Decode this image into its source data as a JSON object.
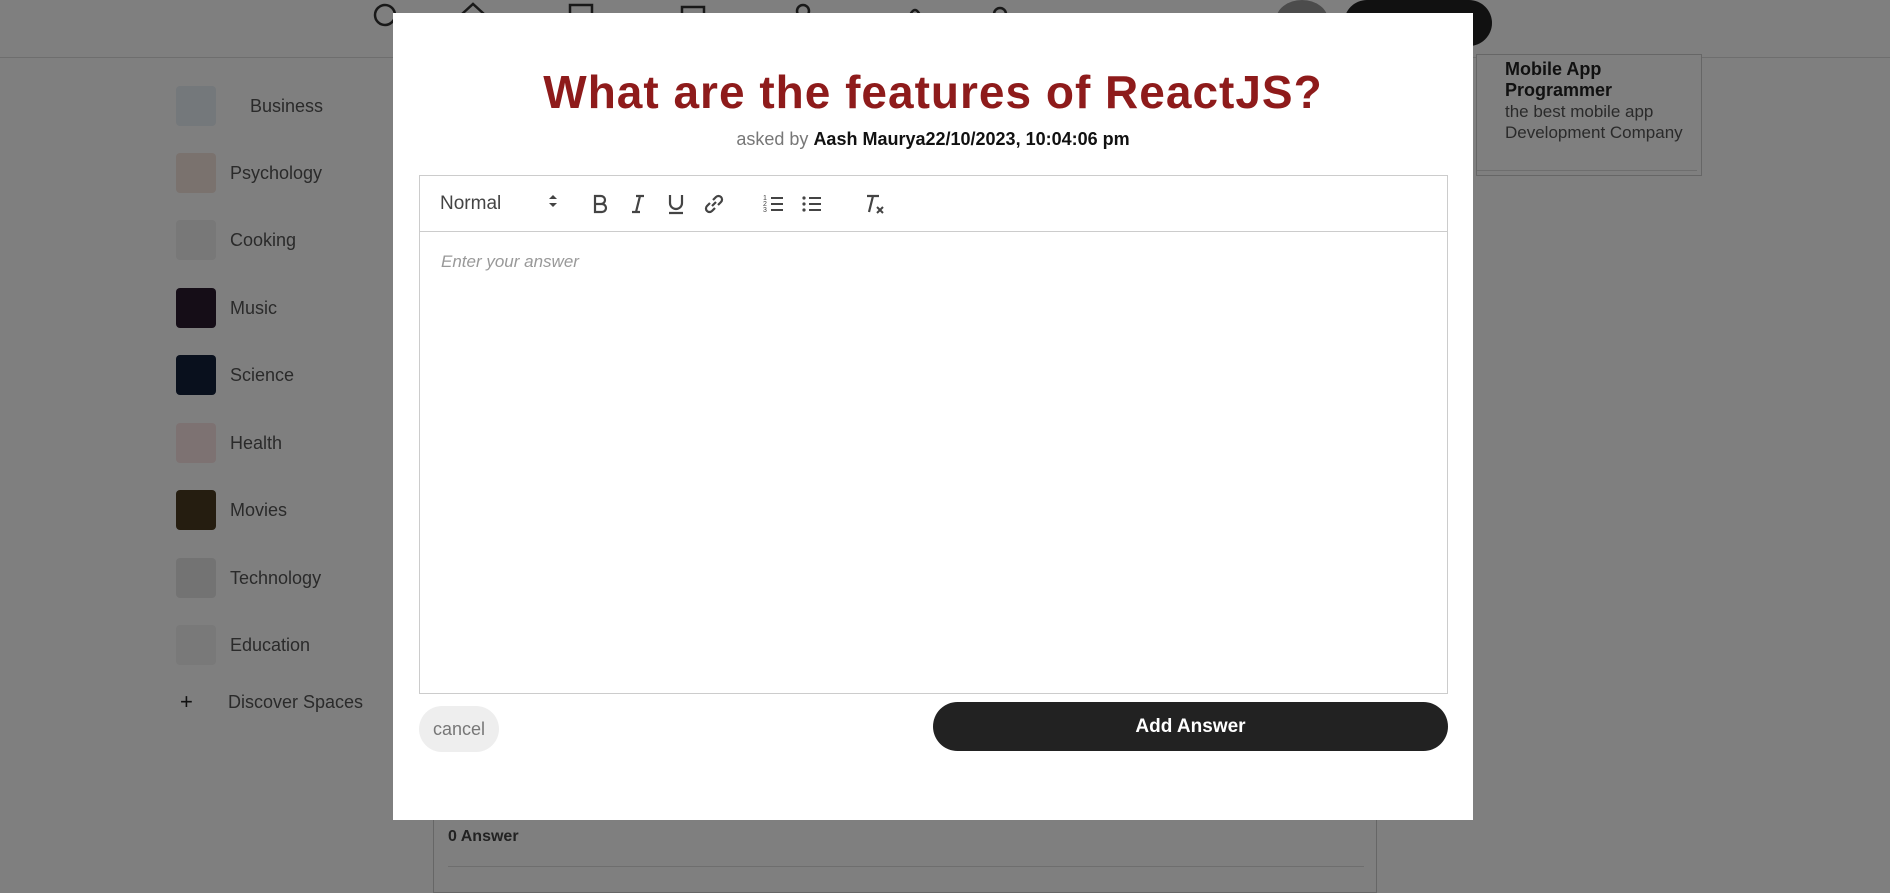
{
  "background": {
    "sidebar": {
      "items": [
        {
          "label": "Business",
          "icon": "business-icon",
          "color": "#e8f0f6"
        },
        {
          "label": "Psychology",
          "icon": "psychology-icon",
          "color": "#f4e4dc"
        },
        {
          "label": "Cooking",
          "icon": "cooking-icon",
          "color": "#f0f0f0"
        },
        {
          "label": "Music",
          "icon": "music-icon",
          "color": "#2a1a2e"
        },
        {
          "label": "Science",
          "icon": "science-icon",
          "color": "#12203a"
        },
        {
          "label": "Health",
          "icon": "health-icon",
          "color": "#fbe4e4"
        },
        {
          "label": "Movies",
          "icon": "movies-icon",
          "color": "#4a3a20"
        },
        {
          "label": "Technology",
          "icon": "technology-icon",
          "color": "#e6e6e6"
        },
        {
          "label": "Education",
          "icon": "education-icon",
          "color": "#f2f2f2"
        }
      ],
      "discover_label": "Discover Spaces"
    },
    "right_card": {
      "title": "Mobile App Programmer",
      "subtitle": "the best mobile app Development Company"
    },
    "feed": {
      "answers_count": "0 Answer"
    }
  },
  "modal": {
    "question": "What are the features of ReactJS?",
    "asked_by_prefix": "asked by",
    "asked_by_user_and_time": "Aash Maurya22/10/2023, 10:04:06 pm",
    "toolbar": {
      "format_select": "Normal",
      "buttons": [
        "bold-icon",
        "italic-icon",
        "underline-icon",
        "link-icon",
        "ordered-list-icon",
        "bullet-list-icon",
        "clear-format-icon"
      ]
    },
    "editor_placeholder": "Enter your answer",
    "cancel_label": "cancel",
    "add_answer_label": "Add Answer"
  }
}
